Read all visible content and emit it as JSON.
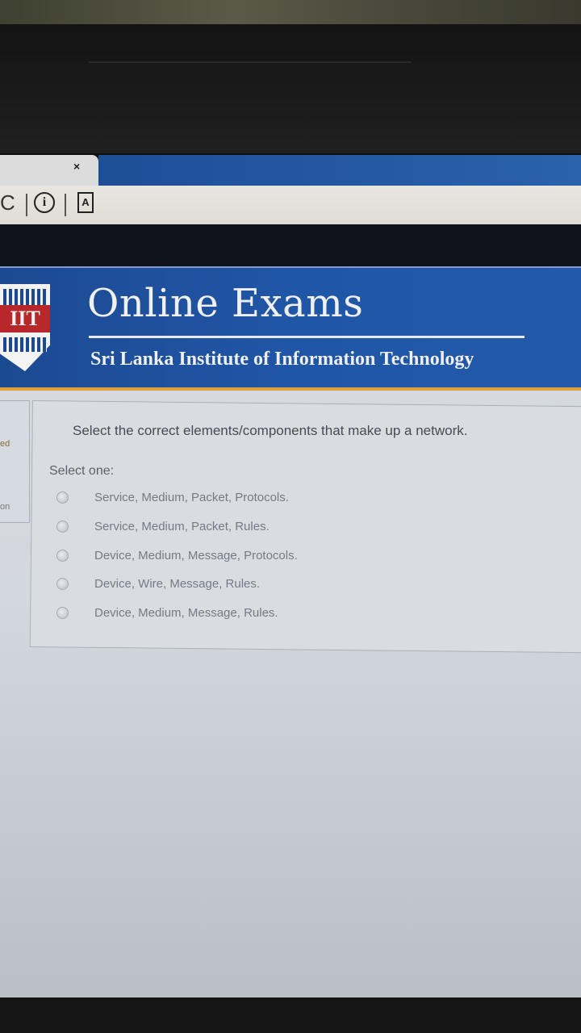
{
  "browser": {
    "tab_close": "×",
    "reload_icon": "C",
    "info_icon": "i",
    "doc_icon": "A"
  },
  "header": {
    "logo_text": "IIT",
    "title": "Online Exams",
    "subtitle": "Sri Lanka Institute of Information Technology"
  },
  "sidebar": {
    "fragment_1": "ed",
    "fragment_2": "on"
  },
  "question": {
    "text": "Select the correct elements/components that make up a network.",
    "prompt": "Select one:",
    "options": [
      {
        "label": "Service, Medium, Packet, Protocols."
      },
      {
        "label": "Service, Medium, Packet, Rules."
      },
      {
        "label": "Device, Medium, Message, Protocols."
      },
      {
        "label": "Device, Wire, Message, Rules."
      },
      {
        "label": "Device, Medium, Message, Rules."
      }
    ]
  },
  "colors": {
    "banner": "#2056a6",
    "accent": "#e0a03a",
    "text": "#454c55"
  }
}
